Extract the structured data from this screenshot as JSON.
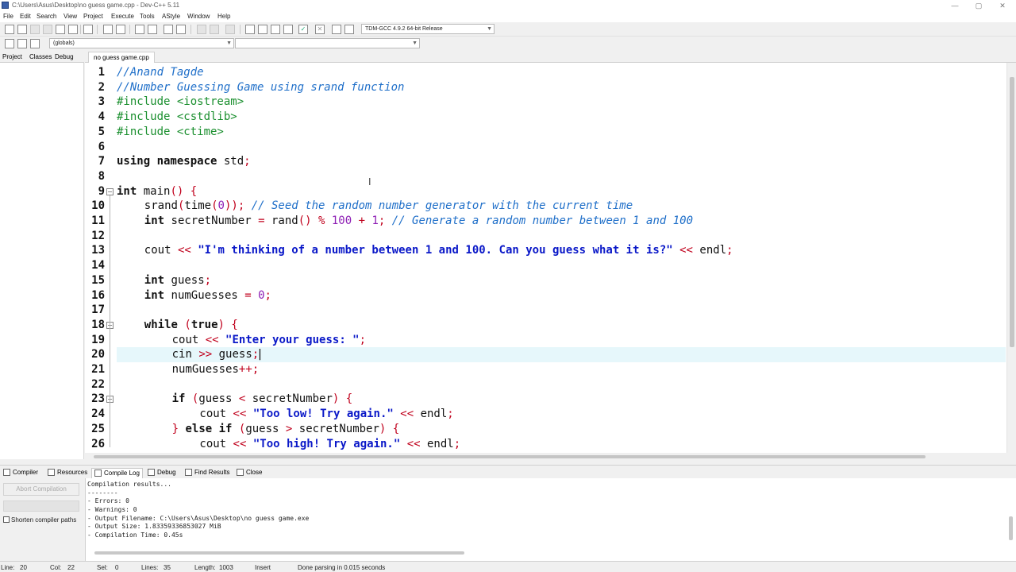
{
  "window": {
    "title": "C:\\Users\\Asus\\Desktop\\no guess game.cpp - Dev-C++ 5.11",
    "minimize": "—",
    "maximize": "▢",
    "close": "✕"
  },
  "menu": [
    "File",
    "Edit",
    "Search",
    "View",
    "Project",
    "Execute",
    "Tools",
    "AStyle",
    "Window",
    "Help"
  ],
  "toolbar": {
    "compiler_select": "TDM-GCC 4.9.2 64-bit Release",
    "scope_select": "(globals)",
    "symbol_select": ""
  },
  "left_panel": {
    "tabs": [
      "Project",
      "Classes",
      "Debug"
    ]
  },
  "editor": {
    "tab_label": "no guess game.cpp",
    "active_line": 20,
    "lines": [
      {
        "n": "1",
        "fold": "",
        "indent": 0,
        "parts": [
          {
            "t": "//Anand Tagde",
            "c": "comment"
          }
        ]
      },
      {
        "n": "2",
        "fold": "",
        "indent": 0,
        "parts": [
          {
            "t": "//Number Guessing Game using srand function",
            "c": "comment"
          }
        ]
      },
      {
        "n": "3",
        "fold": "",
        "indent": 0,
        "parts": [
          {
            "t": "#include <iostream>",
            "c": "pre"
          }
        ]
      },
      {
        "n": "4",
        "fold": "",
        "indent": 0,
        "parts": [
          {
            "t": "#include <cstdlib>",
            "c": "pre"
          }
        ]
      },
      {
        "n": "5",
        "fold": "",
        "indent": 0,
        "parts": [
          {
            "t": "#include <ctime>",
            "c": "pre"
          }
        ]
      },
      {
        "n": "6",
        "fold": "",
        "indent": 0,
        "parts": []
      },
      {
        "n": "7",
        "fold": "",
        "indent": 0,
        "parts": [
          {
            "t": "using namespace",
            "c": "kw"
          },
          {
            "t": " std",
            "c": "id"
          },
          {
            "t": ";",
            "c": "sym"
          }
        ]
      },
      {
        "n": "8",
        "fold": "",
        "indent": 0,
        "parts": []
      },
      {
        "n": "9",
        "fold": "−",
        "indent": 0,
        "parts": [
          {
            "t": "int",
            "c": "kw"
          },
          {
            "t": " main",
            "c": "id"
          },
          {
            "t": "() {",
            "c": "sym"
          }
        ]
      },
      {
        "n": "10",
        "fold": "",
        "indent": 1,
        "parts": [
          {
            "t": "srand",
            "c": "id"
          },
          {
            "t": "(",
            "c": "sym"
          },
          {
            "t": "time",
            "c": "id"
          },
          {
            "t": "(",
            "c": "sym"
          },
          {
            "t": "0",
            "c": "num"
          },
          {
            "t": "));",
            "c": "sym"
          },
          {
            "t": " // Seed the random number generator with the current time",
            "c": "comment"
          }
        ]
      },
      {
        "n": "11",
        "fold": "",
        "indent": 1,
        "parts": [
          {
            "t": "int",
            "c": "kw"
          },
          {
            "t": " secretNumber ",
            "c": "id"
          },
          {
            "t": "=",
            "c": "sym"
          },
          {
            "t": " rand",
            "c": "id"
          },
          {
            "t": "() %",
            "c": "sym"
          },
          {
            "t": " 100 ",
            "c": "num"
          },
          {
            "t": "+",
            "c": "sym"
          },
          {
            "t": " 1",
            "c": "num"
          },
          {
            "t": ";",
            "c": "sym"
          },
          {
            "t": " // Generate a random number between 1 and 100",
            "c": "comment"
          }
        ]
      },
      {
        "n": "12",
        "fold": "",
        "indent": 1,
        "parts": []
      },
      {
        "n": "13",
        "fold": "",
        "indent": 1,
        "parts": [
          {
            "t": "cout ",
            "c": "id"
          },
          {
            "t": "<<",
            "c": "sym"
          },
          {
            "t": " \"I'm thinking of a number between 1 and 100. Can you guess what it is?\"",
            "c": "str"
          },
          {
            "t": " <<",
            "c": "sym"
          },
          {
            "t": " endl",
            "c": "id"
          },
          {
            "t": ";",
            "c": "sym"
          }
        ]
      },
      {
        "n": "14",
        "fold": "",
        "indent": 1,
        "parts": []
      },
      {
        "n": "15",
        "fold": "",
        "indent": 1,
        "parts": [
          {
            "t": "int",
            "c": "kw"
          },
          {
            "t": " guess",
            "c": "id"
          },
          {
            "t": ";",
            "c": "sym"
          }
        ]
      },
      {
        "n": "16",
        "fold": "",
        "indent": 1,
        "parts": [
          {
            "t": "int",
            "c": "kw"
          },
          {
            "t": " numGuesses ",
            "c": "id"
          },
          {
            "t": "=",
            "c": "sym"
          },
          {
            "t": " 0",
            "c": "num"
          },
          {
            "t": ";",
            "c": "sym"
          }
        ]
      },
      {
        "n": "17",
        "fold": "",
        "indent": 1,
        "parts": []
      },
      {
        "n": "18",
        "fold": "−",
        "indent": 1,
        "parts": [
          {
            "t": "while",
            "c": "kw"
          },
          {
            "t": " (",
            "c": "sym"
          },
          {
            "t": "true",
            "c": "kw"
          },
          {
            "t": ") {",
            "c": "sym"
          }
        ]
      },
      {
        "n": "19",
        "fold": "",
        "indent": 2,
        "parts": [
          {
            "t": "cout ",
            "c": "id"
          },
          {
            "t": "<<",
            "c": "sym"
          },
          {
            "t": " \"Enter your guess: \"",
            "c": "str"
          },
          {
            "t": ";",
            "c": "sym"
          }
        ]
      },
      {
        "n": "20",
        "fold": "",
        "indent": 2,
        "parts": [
          {
            "t": "cin ",
            "c": "id"
          },
          {
            "t": ">>",
            "c": "sym"
          },
          {
            "t": " guess",
            "c": "id"
          },
          {
            "t": ";",
            "c": "sym"
          },
          {
            "t": "|",
            "c": "cursor"
          }
        ]
      },
      {
        "n": "21",
        "fold": "",
        "indent": 2,
        "parts": [
          {
            "t": "numGuesses",
            "c": "id"
          },
          {
            "t": "++;",
            "c": "sym"
          }
        ]
      },
      {
        "n": "22",
        "fold": "",
        "indent": 2,
        "parts": []
      },
      {
        "n": "23",
        "fold": "−",
        "indent": 2,
        "parts": [
          {
            "t": "if",
            "c": "kw"
          },
          {
            "t": " (",
            "c": "sym"
          },
          {
            "t": "guess ",
            "c": "id"
          },
          {
            "t": "<",
            "c": "sym"
          },
          {
            "t": " secretNumber",
            "c": "id"
          },
          {
            "t": ") {",
            "c": "sym"
          }
        ]
      },
      {
        "n": "24",
        "fold": "",
        "indent": 3,
        "parts": [
          {
            "t": "cout ",
            "c": "id"
          },
          {
            "t": "<<",
            "c": "sym"
          },
          {
            "t": " \"Too low! Try again.\"",
            "c": "str"
          },
          {
            "t": " <<",
            "c": "sym"
          },
          {
            "t": " endl",
            "c": "id"
          },
          {
            "t": ";",
            "c": "sym"
          }
        ]
      },
      {
        "n": "25",
        "fold": "",
        "indent": 2,
        "parts": [
          {
            "t": "}",
            "c": "sym"
          },
          {
            "t": " else if",
            "c": "kw"
          },
          {
            "t": " (",
            "c": "sym"
          },
          {
            "t": "guess ",
            "c": "id"
          },
          {
            "t": ">",
            "c": "sym"
          },
          {
            "t": " secretNumber",
            "c": "id"
          },
          {
            "t": ") {",
            "c": "sym"
          }
        ]
      },
      {
        "n": "26",
        "fold": "",
        "indent": 3,
        "parts": [
          {
            "t": "cout ",
            "c": "id"
          },
          {
            "t": "<<",
            "c": "sym"
          },
          {
            "t": " \"Too high! Try again.\"",
            "c": "str"
          },
          {
            "t": " <<",
            "c": "sym"
          },
          {
            "t": " endl",
            "c": "id"
          },
          {
            "t": ";",
            "c": "sym"
          }
        ]
      }
    ]
  },
  "colors": {
    "comment": "#1f6fc9",
    "pre": "#1a8f2e",
    "kw": "#111111",
    "id": "#111111",
    "sym": "#c0001c",
    "num": "#8e1fb5",
    "str": "#0a18c8",
    "active_line": "#e6f7fb"
  },
  "bottom_tabs": [
    "Compiler",
    "Resources",
    "Compile Log",
    "Debug",
    "Find Results",
    "Close"
  ],
  "compile_panel": {
    "abort_label": "Abort Compilation",
    "shorten_label": "Shorten compiler paths",
    "log": [
      "Compilation results...",
      "--------",
      "- Errors: 0",
      "- Warnings: 0",
      "- Output Filename: C:\\Users\\Asus\\Desktop\\no guess game.exe",
      "- Output Size: 1.83359336853027 MiB",
      "- Compilation Time: 0.45s"
    ]
  },
  "status": {
    "line_label": "Line:",
    "line": "20",
    "col_label": "Col:",
    "col": "22",
    "sel_label": "Sel:",
    "sel": "0",
    "lines_label": "Lines:",
    "lines": "35",
    "length_label": "Length:",
    "length": "1003",
    "mode": "Insert",
    "message": "Done parsing in 0.015 seconds"
  }
}
